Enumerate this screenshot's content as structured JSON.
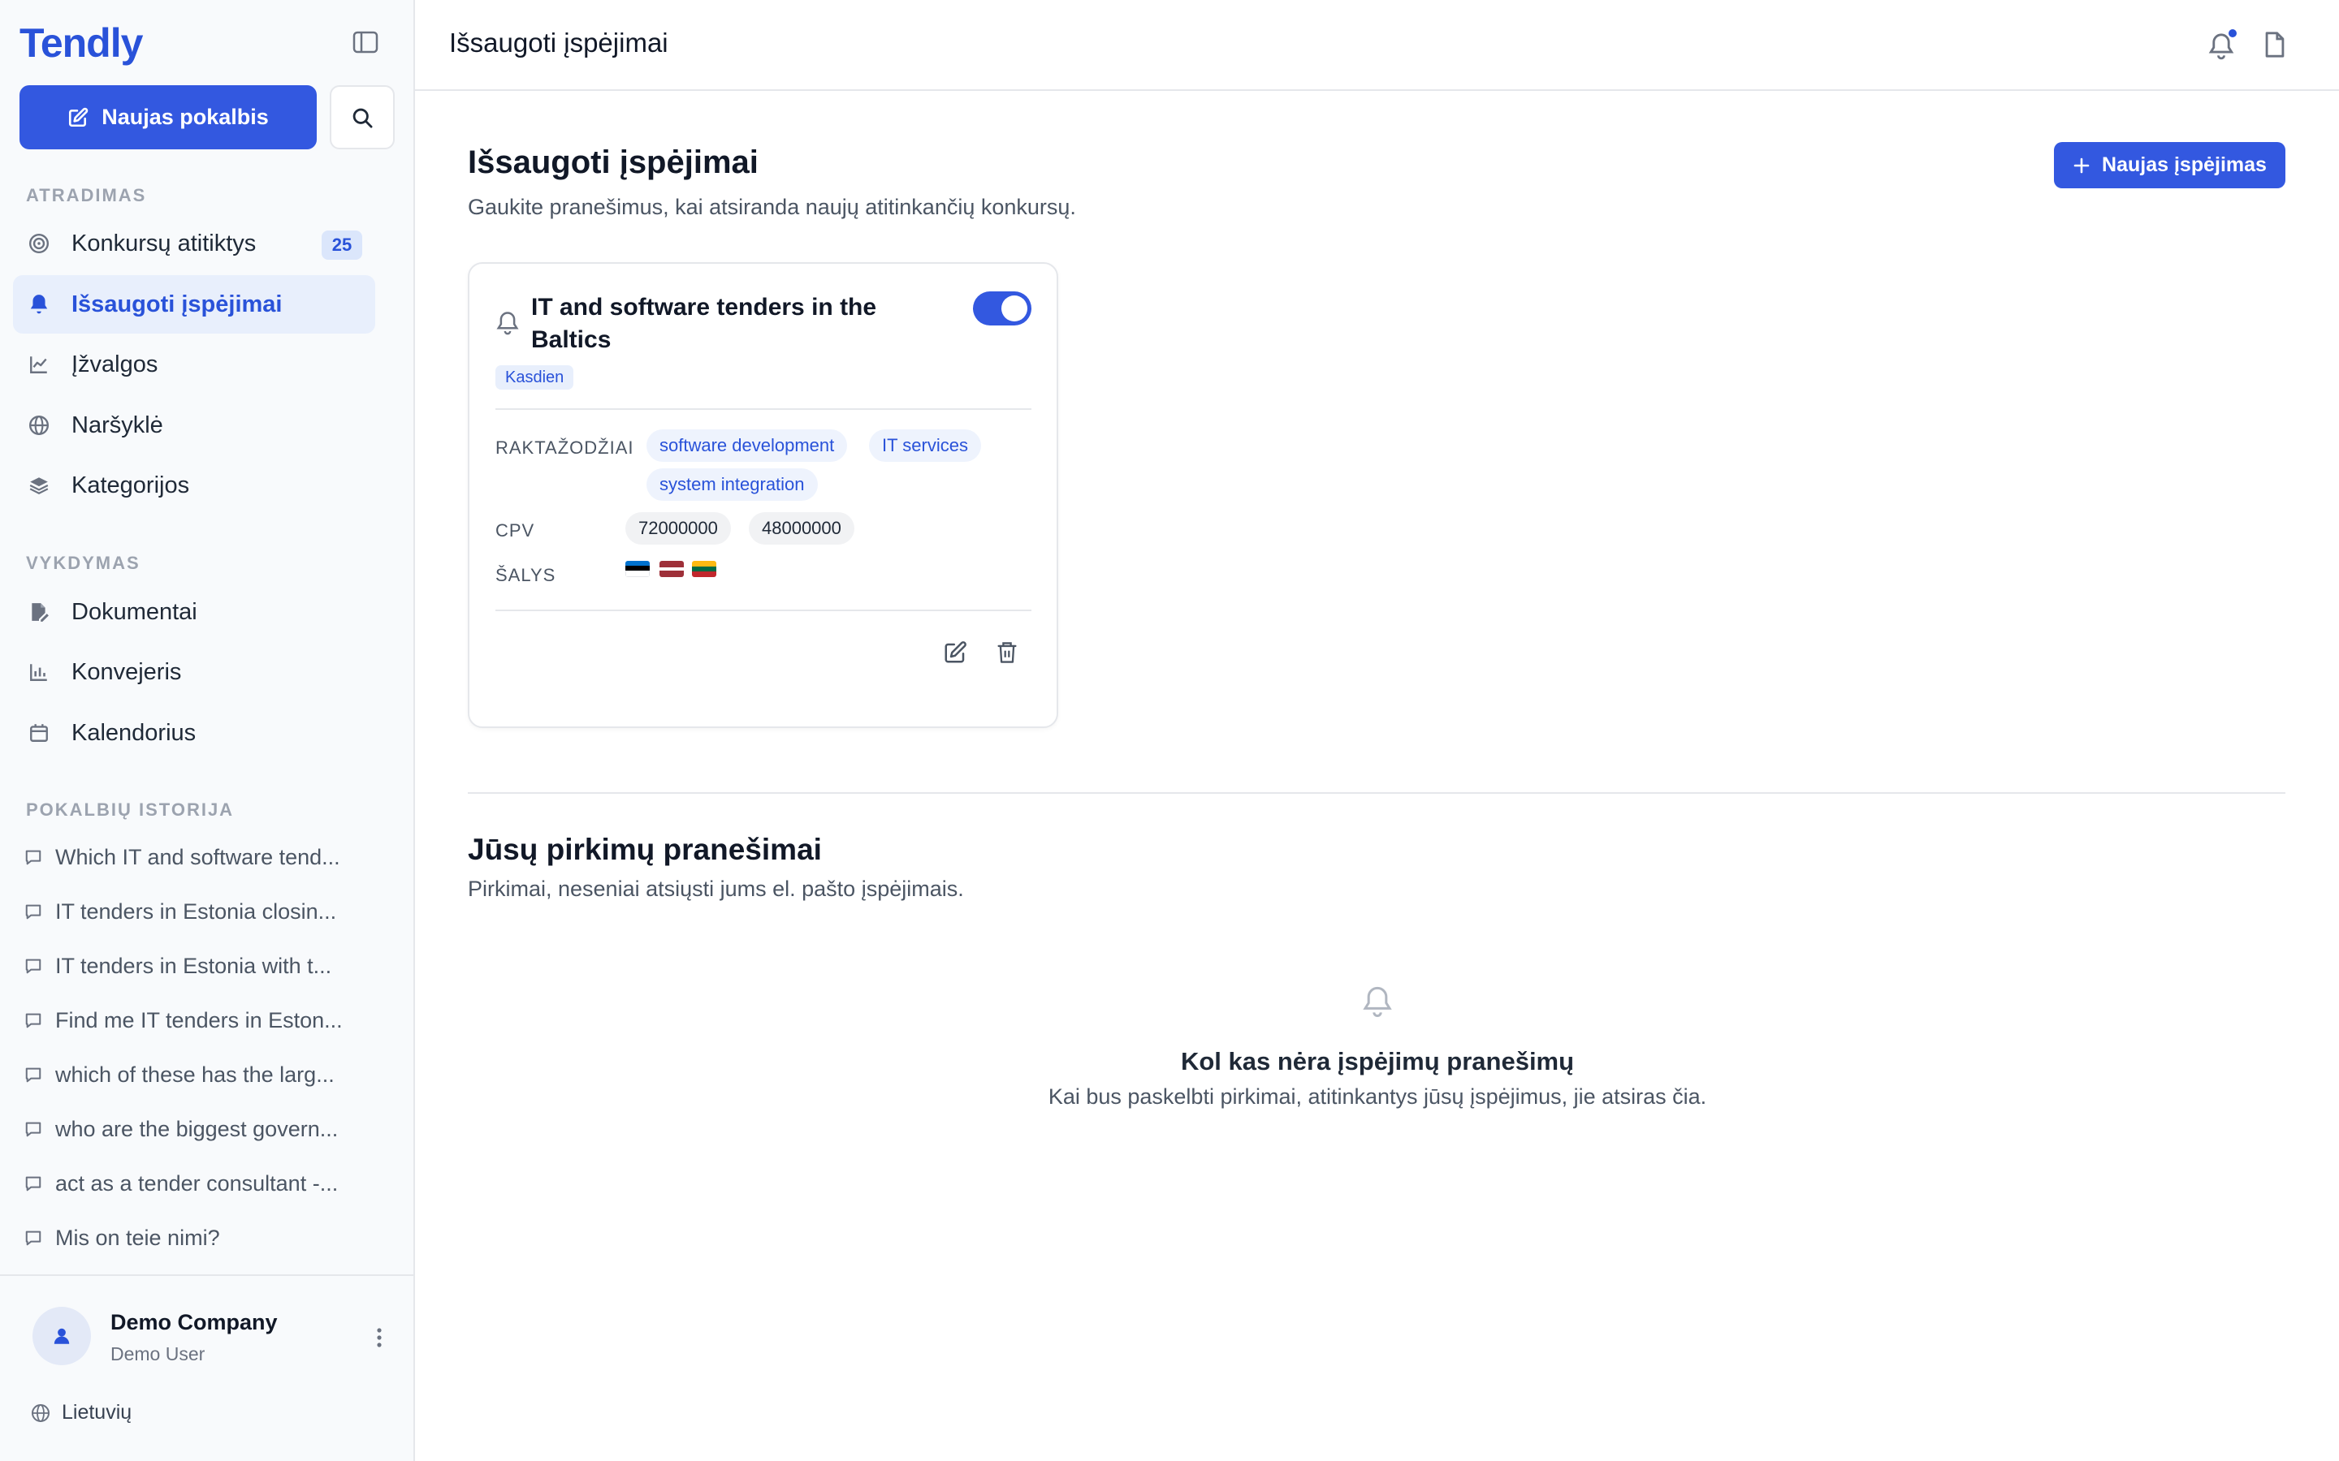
{
  "app": {
    "logo": "Tendly"
  },
  "sidebar": {
    "new_chat_label": "Naujas pokalbis",
    "sections": {
      "discovery": "ATRADIMAS",
      "execution": "VYKDYMAS",
      "history": "POKALBIŲ ISTORIJA"
    },
    "discovery_items": [
      {
        "label": "Konkursų atitiktys",
        "icon": "target-icon",
        "badge": "25"
      },
      {
        "label": "Išsaugoti įspėjimai",
        "icon": "bell-icon",
        "active": true
      },
      {
        "label": "Įžvalgos",
        "icon": "line-chart-icon"
      },
      {
        "label": "Naršyklė",
        "icon": "globe-icon"
      },
      {
        "label": "Kategorijos",
        "icon": "layers-icon"
      }
    ],
    "execution_items": [
      {
        "label": "Dokumentai",
        "icon": "file-edit-icon"
      },
      {
        "label": "Konvejeris",
        "icon": "bar-chart-icon"
      },
      {
        "label": "Kalendorius",
        "icon": "calendar-icon"
      }
    ],
    "history_items": [
      "Which IT and software tend...",
      "IT tenders in Estonia closin...",
      "IT tenders in Estonia with t...",
      "Find me IT tenders in Eston...",
      "which of these has the larg...",
      "who are the biggest govern...",
      "act as a tender consultant -...",
      "Mis on teie nimi?"
    ],
    "user": {
      "company": "Demo Company",
      "name": "Demo User"
    },
    "language": "Lietuvių"
  },
  "topbar": {
    "title": "Išsaugoti įspėjimai"
  },
  "main": {
    "title": "Išsaugoti įspėjimai",
    "subtitle": "Gaukite pranešimus, kai atsiranda naujų atitinkančių konkursų.",
    "new_alert_label": "Naujas įspėjimas",
    "alert_card": {
      "title": "IT and software tenders in the Baltics",
      "frequency": "Kasdien",
      "enabled": true,
      "keywords_label": "RAKTAŽODŽIAI",
      "keywords": [
        "software development",
        "IT services",
        "system integration"
      ],
      "cpv_label": "CPV",
      "cpv": [
        "72000000",
        "48000000"
      ],
      "countries_label": "ŠALYS",
      "countries": [
        "EE",
        "LV",
        "LT"
      ]
    },
    "notifications": {
      "title": "Jūsų pirkimų pranešimai",
      "subtitle": "Pirkimai, neseniai atsiųsti jums el. pašto įspėjimais.",
      "empty_title": "Kol kas nėra įspėjimų pranešimų",
      "empty_subtitle": "Kai bus paskelbti pirkimai, atitinkantys jūsų įspėjimus, jie atsiras čia."
    }
  },
  "colors": {
    "accent": "#3358e0",
    "accent_text": "#2952d9",
    "active_bg": "#e8effc"
  }
}
